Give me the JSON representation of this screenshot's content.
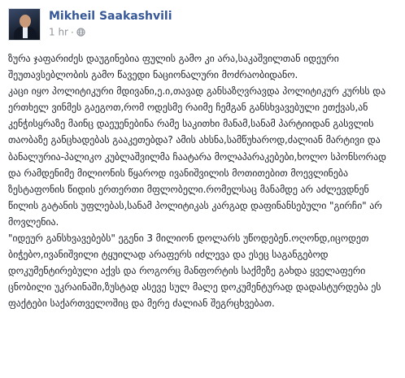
{
  "post": {
    "author": "Mikheil Saakashvili",
    "time": "1 hr",
    "separator": "·",
    "privacy_icon": "globe-icon",
    "paragraphs": [
      "ზურა ჯაფარიძეს დაუგინებია ფულის გამო კი არა,საკაშვილთან იდეური შეუთავსებლობის გამო წავედი ნაციონალური მოძრაობიდანო.",
      "კაცი იყო პოლიტიკური მდივანი,ე.ი,თავად განსაზღვრავდა პოლიტიკურ კურსს და ერთხელ ვინმეს გაეგოთ,რომ ოდესმე რაიმე ჩემგან განსხვავებული ეთქვას,ან კენჭისყრაზე მაინც დაეუენებინა რამე საკითხი მანამ,სანამ პარტიიდან გასვლის თაობაზე განცხადებას გააკეთებდა? ამის ახსნა,სამწუხაროდ,ძალიან მარტივი და ბანალურია-პალიკო კუბლაშვილმა ჩაატარა მოლაპარაკებები,ხოლო სპონსორად და რამდენიმე მილიონის წყაროდ ივანიშვილის მოთითებით მოევლინება ზესტაფონის წიდის ერთერთი მფლობელი.რომელსაც მანამდე არ აძლევდნენ წილის გატანის უფლებას,სანამ პოლიტიკას კარგად დაფინანსებული \"გირჩი\" არ მოვლენია.",
      "\"იდეურ განსხვავებებს\" ეგენი 3 მილიონ დოლარს უწოდებენ.ოღონდ,იცოდეთ ბიჭებო,ივანიშვილი ტყუილად არაფერს იძლევა და ესეც საგანგებოდ დოკუმენტირებული აქვს და როგორც მანფორტის საქმეზე გახდა ყველაფერი ცნობილი უკრაინაში,ზუსტად ასევე სულ მალე დოკუმენტურად დადასტურდება ეს ფაქტები საქართველოშიც და მერე ძალიან შეგრცხვებათ."
    ],
    "colors": {
      "author": "#365899",
      "meta": "#90949c",
      "text": "#1d2129"
    }
  }
}
